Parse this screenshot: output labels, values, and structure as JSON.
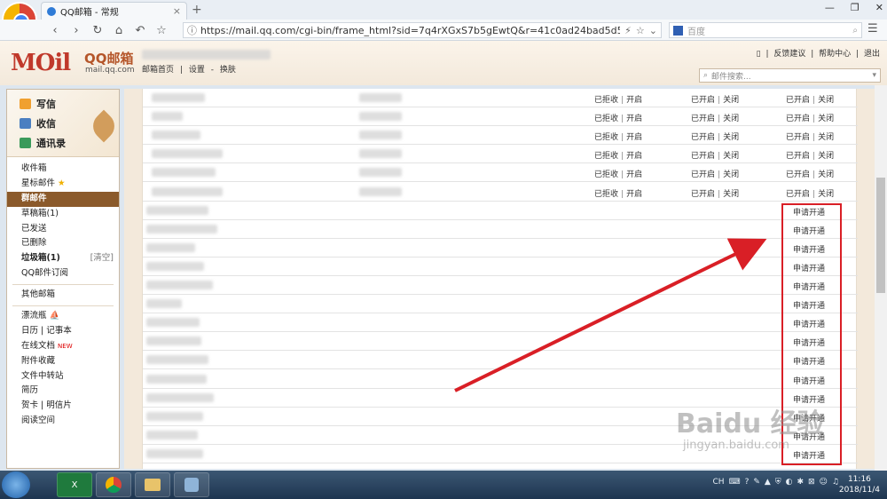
{
  "browser": {
    "tab_title": "QQ邮箱 - 常规",
    "tab_close": "×",
    "new_tab": "+",
    "window_controls": [
      "—",
      "❐",
      "✕"
    ],
    "nav": [
      "‹",
      "›",
      "↻",
      "⌂",
      "↶",
      "☆"
    ],
    "url": "https://mail.qq.com/cgi-bin/frame_html?sid=7q4rXGxS7b5gEwtQ&r=41c0ad24bad5d56301289...",
    "url_info": "ⓘ",
    "url_icons": [
      "⚡",
      "☆",
      "⌄"
    ],
    "search_engine": "百度",
    "menu": "☰"
  },
  "header": {
    "logo": "MOil",
    "brand": "QQ邮箱",
    "domain": "mail.qq.com",
    "links": [
      "邮箱首页",
      "|",
      "设置",
      "-",
      "换肤"
    ],
    "top_links": [
      "▯",
      "|",
      "反馈建议",
      "|",
      "帮助中心",
      "|",
      "退出"
    ],
    "search_placeholder": "邮件搜索..."
  },
  "sidebar": {
    "write": "写信",
    "inbox": "收信",
    "contacts": "通讯录",
    "folders": [
      {
        "label": "收件箱"
      },
      {
        "label": "星标邮件",
        "star": "★"
      },
      {
        "label": "群邮件",
        "selected": true
      },
      {
        "label": "草稿箱(1)"
      },
      {
        "label": "已发送"
      },
      {
        "label": "已删除"
      },
      {
        "label": "垃圾箱(1)",
        "bold": true,
        "extra": "[清空]"
      },
      {
        "label": "QQ邮件订阅"
      }
    ],
    "other": "其他邮箱",
    "apps": [
      "漂流瓶 ⛵",
      "日历 | 记事本",
      "在线文档",
      "附件收藏",
      "文件中转站",
      "简历",
      "贺卡 | 明信片",
      "阅读空间"
    ],
    "new_badge": "NEW"
  },
  "table": {
    "status_rows": [
      {
        "s1": [
          "已拒收",
          "开启"
        ],
        "s2": [
          "已开启",
          "关闭"
        ],
        "s3": [
          "已开启",
          "关闭"
        ]
      },
      {
        "s1": [
          "已拒收",
          "开启"
        ],
        "s2": [
          "已开启",
          "关闭"
        ],
        "s3": [
          "已开启",
          "关闭"
        ]
      },
      {
        "s1": [
          "已拒收",
          "开启"
        ],
        "s2": [
          "已开启",
          "关闭"
        ],
        "s3": [
          "已开启",
          "关闭"
        ]
      },
      {
        "s1": [
          "已拒收",
          "开启"
        ],
        "s2": [
          "已开启",
          "关闭"
        ],
        "s3": [
          "已开启",
          "关闭"
        ]
      },
      {
        "s1": [
          "已拒收",
          "开启"
        ],
        "s2": [
          "已开启",
          "关闭"
        ],
        "s3": [
          "已开启",
          "关闭"
        ]
      },
      {
        "s1": [
          "已拒收",
          "开启"
        ],
        "s2": [
          "已开启",
          "关闭"
        ],
        "s3": [
          "已开启",
          "关闭"
        ]
      }
    ],
    "apply_label": "申请开通",
    "apply_rows": 14,
    "separator": "|"
  },
  "watermark": {
    "line1": "Baidu 经验",
    "line2": "jingyan.baidu.com"
  },
  "taskbar": {
    "apps": [
      "X",
      "",
      "",
      ""
    ],
    "tray": [
      "CH",
      "⌨",
      "?",
      "✎",
      "▲",
      "⛨",
      "◐",
      "✱",
      "⊠",
      "☺",
      "♫"
    ],
    "time": "11:16",
    "date": "2018/11/4"
  },
  "colors": {
    "accent": "#8b5a2b",
    "annotation": "#d91f26"
  }
}
